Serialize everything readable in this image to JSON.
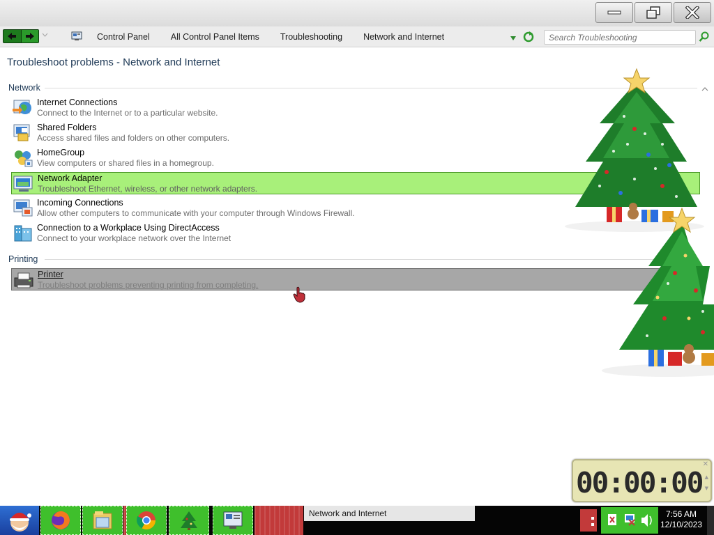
{
  "window": {
    "controls": [
      "minimize",
      "restore",
      "close"
    ]
  },
  "address_bar": {
    "breadcrumbs": [
      "Control Panel",
      "All Control Panel Items",
      "Troubleshooting",
      "Network and Internet"
    ],
    "search_placeholder": "Search Troubleshooting"
  },
  "page": {
    "title": "Troubleshoot problems - Network and Internet"
  },
  "groups": [
    {
      "header": "Network",
      "items": [
        {
          "title": "Internet Connections",
          "desc": "Connect to the Internet or to a particular website.",
          "icon": "globe-network-icon",
          "state": "normal"
        },
        {
          "title": "Shared Folders",
          "desc": "Access shared files and folders on other computers.",
          "icon": "shared-folders-icon",
          "state": "normal"
        },
        {
          "title": "HomeGroup",
          "desc": "View computers or shared files in a homegroup.",
          "icon": "homegroup-icon",
          "state": "normal"
        },
        {
          "title": "Network Adapter",
          "desc": "Troubleshoot Ethernet, wireless, or other network adapters.",
          "icon": "network-adapter-icon",
          "state": "highlighted"
        },
        {
          "title": "Incoming Connections",
          "desc": "Allow other computers to communicate with your computer through Windows Firewall.",
          "icon": "incoming-connections-icon",
          "state": "normal"
        },
        {
          "title": "Connection to a Workplace Using DirectAccess",
          "desc": "Connect to your workplace network over the Internet",
          "icon": "directaccess-icon",
          "state": "normal"
        }
      ]
    },
    {
      "header": "Printing",
      "items": [
        {
          "title": "Printer",
          "desc": "Troubleshoot problems preventing printing from completing.",
          "icon": "printer-icon",
          "state": "selected"
        }
      ]
    }
  ],
  "timer": {
    "display": "00:00:00"
  },
  "taskbar": {
    "active_window": "Network and Internet",
    "clock_time": "7:56 AM",
    "clock_date": "12/10/2023",
    "pinned": [
      "firefox-icon",
      "file-explorer-icon",
      "chrome-icon",
      "christmas-tree-icon",
      "control-panel-icon"
    ]
  },
  "colors": {
    "highlight": "#a8f07a",
    "selected": "#a7a7a7",
    "taskbar_green": "#3fbf2c",
    "taskbar_red": "#c23a3a"
  }
}
